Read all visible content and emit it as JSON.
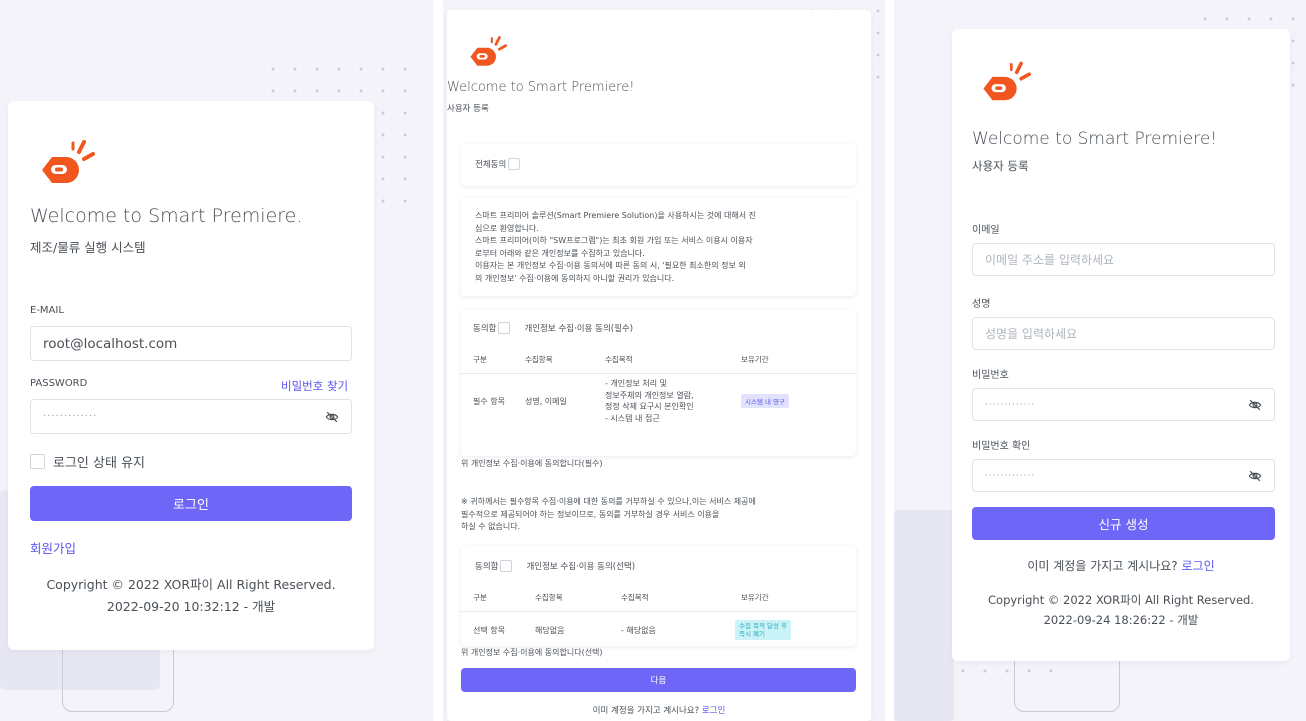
{
  "colors": {
    "accent": "#6e66f6",
    "logo_orange": "#f1561f",
    "panel_bg": "#f3f3f9"
  },
  "login": {
    "title": "Welcome to Smart Premiere.",
    "subtitle": "제조/물류 실행 시스템",
    "email_label": "E-MAIL",
    "email_value": "root@localhost.com",
    "password_label": "PASSWORD",
    "forgot_password": "비밀번호 찾기",
    "password_value": "·············",
    "remember_label": "로그인 상태 유지",
    "login_button": "로그인",
    "signup_link": "회원가입",
    "copyright": "Copyright © 2022 XOR파이 All Right Reserved.",
    "build": "2022-09-20 10:32:12 - 개발"
  },
  "terms": {
    "title": "Welcome to Smart Premiere!",
    "subtitle": "사용자 등록",
    "agree_all": "전체동의",
    "intro_lines": [
      "스마트 프리미어 솔루션(Smart Premiere Solution)을 사용하시는 것에 대해서 진",
      "심으로 환영합니다.",
      "스마트 프리미어(이하 \"SW프로그램\")는 최초 회원 가입 또는 서비스 이용시 이용자",
      "로부터 아래와 같은 개인정보를 수집하고 있습니다.",
      "이용자는 본 개인정보 수집·이용 동의서에 따른 동의 시, '필요한 최소한의 정보 외",
      "의 개인정보' 수집·이용에 동의하지 아니할 권리가 있습니다."
    ],
    "agree_label": "동의함",
    "required_title": "개인정보 수집·이용 동의(필수)",
    "headers": [
      "구분",
      "수집항목",
      "수집목적",
      "보유기간"
    ],
    "required_row": {
      "type": "필수 항목",
      "items": "성명, 이메일",
      "purpose_lines": [
        "- 개인정보 처리 및",
        "정보주체의 개인정보 열람,",
        "정정 삭제 요구시 본인확인",
        "- 시스템 내 접근"
      ],
      "period": "시스템 내 영구"
    },
    "required_note": "위 개인정보 수집·이용에 동의합니다(필수)",
    "warning_lines": [
      "※ 귀하께서는 필수항목 수집·이용에 대한 동의를 거부하실 수 있으나,이는 서비스 제공에",
      "필수적으로 제공되어야 하는 정보이므로, 동의를 거부하실 경우 서비스 이용을",
      "하실 수 없습니다."
    ],
    "optional_title": "개인정보 수집·이용 동의(선택)",
    "optional_row": {
      "type": "선택 항목",
      "items": "해당없음",
      "purpose": "- 해당없음",
      "period_lines": [
        "수집 목적 달성 후",
        "즉시 폐기"
      ]
    },
    "optional_note": "위 개인정보 수집·이용에 동의합니다(선택)",
    "next_button": "다음",
    "have_account": "이미 계정을 가지고 계시나요?",
    "login_link": "로그인"
  },
  "register": {
    "title": "Welcome to Smart Premiere!",
    "subtitle": "사용자 등록",
    "email_label": "이메일",
    "email_placeholder": "이메일 주소를 입력하세요",
    "name_label": "성명",
    "name_placeholder": "성명을 입력하세요",
    "password_label": "비밀번호",
    "password_value": "·············",
    "confirm_label": "비밀번호 확인",
    "confirm_value": "·············",
    "create_button": "신규 생성",
    "have_account": "이미 계정을 가지고 계시나요?",
    "login_link": "로그인",
    "copyright": "Copyright © 2022 XOR파이 All Right Reserved.",
    "build": "2022-09-24 18:26:22 - 개발"
  }
}
